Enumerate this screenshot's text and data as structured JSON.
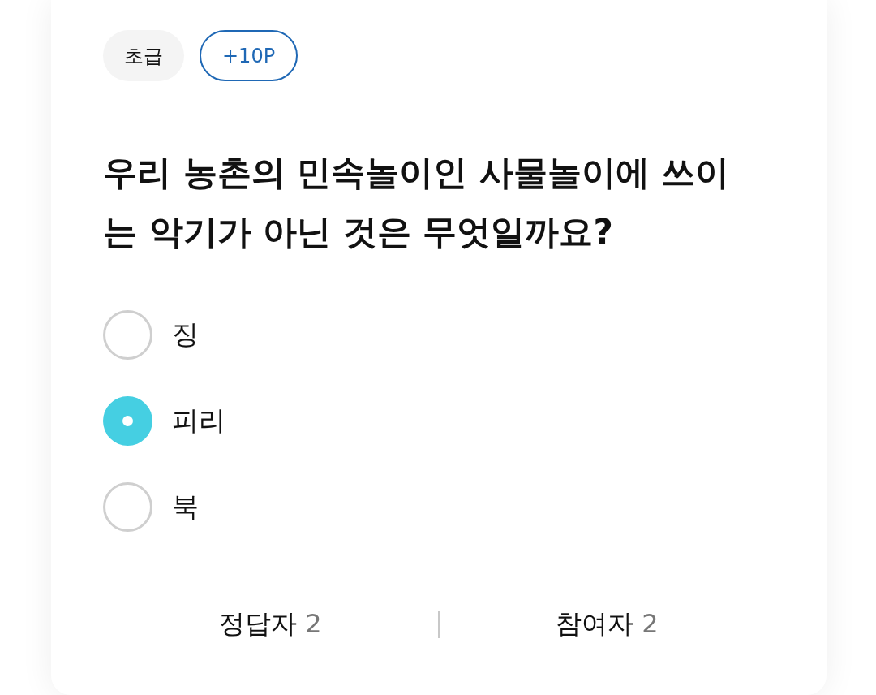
{
  "tags": [
    {
      "kind": "level",
      "text": "초급"
    },
    {
      "kind": "points",
      "text": "+10P"
    }
  ],
  "question": "우리 농촌의 민속놀이인 사물놀이에 쓰이는 악기가 아닌 것은 무엇일까요?",
  "options": [
    {
      "label": "징",
      "selected": false
    },
    {
      "label": "피리",
      "selected": true
    },
    {
      "label": "북",
      "selected": false
    }
  ],
  "stats": [
    {
      "label": "정답자",
      "count": "2"
    },
    {
      "label": "참여자",
      "count": "2"
    }
  ]
}
